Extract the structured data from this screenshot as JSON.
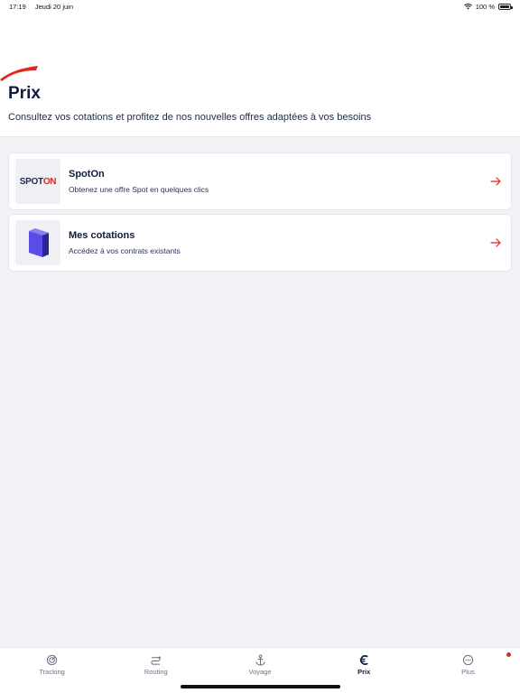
{
  "status_bar": {
    "time": "17:19",
    "date": "Jeudi 20 juin",
    "battery": "100 %"
  },
  "header": {
    "title": "Prix",
    "subtitle": "Consultez vos cotations et profitez de nos nouvelles offres adaptées à vos besoins"
  },
  "cards": [
    {
      "logo_text_1": "SPOT",
      "logo_text_2": "ON",
      "title": "SpotOn",
      "description": "Obtenez une offre Spot en quelques clics"
    },
    {
      "title": "Mes cotations",
      "description": "Accédez à vos contrats existants"
    }
  ],
  "tabs": [
    {
      "label": "Tracking",
      "icon": "tracking-icon"
    },
    {
      "label": "Routing",
      "icon": "routing-icon"
    },
    {
      "label": "Voyage",
      "icon": "anchor-icon"
    },
    {
      "label": "Prix",
      "icon": "euro-icon",
      "active": true
    },
    {
      "label": "Plus",
      "icon": "more-icon",
      "badge": true
    }
  ],
  "colors": {
    "accent": "#e1261c",
    "navy": "#101c3d",
    "background": "#f0f2f6"
  }
}
